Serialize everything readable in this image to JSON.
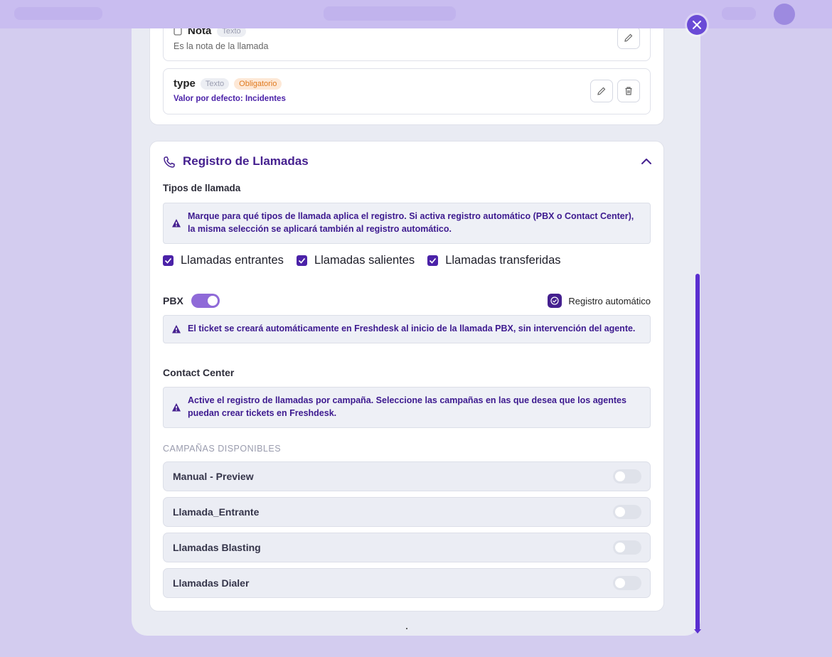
{
  "fields": [
    {
      "name": "Nota",
      "type_chip": "Texto",
      "description": "Es la nota de la llamada"
    },
    {
      "name": "type",
      "type_chip": "Texto",
      "required_chip": "Obligatorio",
      "default_value": "Valor por defecto: Incidentes"
    }
  ],
  "call_log": {
    "title": "Registro de Llamadas",
    "call_types_heading": "Tipos de llamada",
    "call_types_notice": "Marque para qué tipos de llamada aplica el registro. Si activa registro automático (PBX o Contact Center), la misma selección se aplicará también al registro automático.",
    "call_types": [
      {
        "label": "Llamadas entrantes",
        "checked": true
      },
      {
        "label": "Llamadas salientes",
        "checked": true
      },
      {
        "label": "Llamadas transferidas",
        "checked": true
      }
    ],
    "pbx": {
      "label": "PBX",
      "enabled": true,
      "auto_label": "Registro automático",
      "auto_checked": true,
      "notice": "El ticket se creará automáticamente en Freshdesk al inicio de la llamada PBX, sin intervención del agente."
    },
    "contact_center": {
      "heading": "Contact Center",
      "notice": "Active el registro de llamadas por campaña. Seleccione las campañas en las que desea que los agentes puedan crear tickets en Freshdesk.",
      "campaigns_heading": "CAMPAÑAS DISPONIBLES",
      "campaigns": [
        {
          "label": "Manual - Preview",
          "enabled": false
        },
        {
          "label": "Llamada_Entrante",
          "enabled": false
        },
        {
          "label": "Llamadas Blasting",
          "enabled": false
        },
        {
          "label": "Llamadas Dialer",
          "enabled": false
        }
      ]
    }
  },
  "colors": {
    "accent": "#45208f",
    "warning_chip": "#e07a1f",
    "toggle_on": "#8f6ad8"
  }
}
